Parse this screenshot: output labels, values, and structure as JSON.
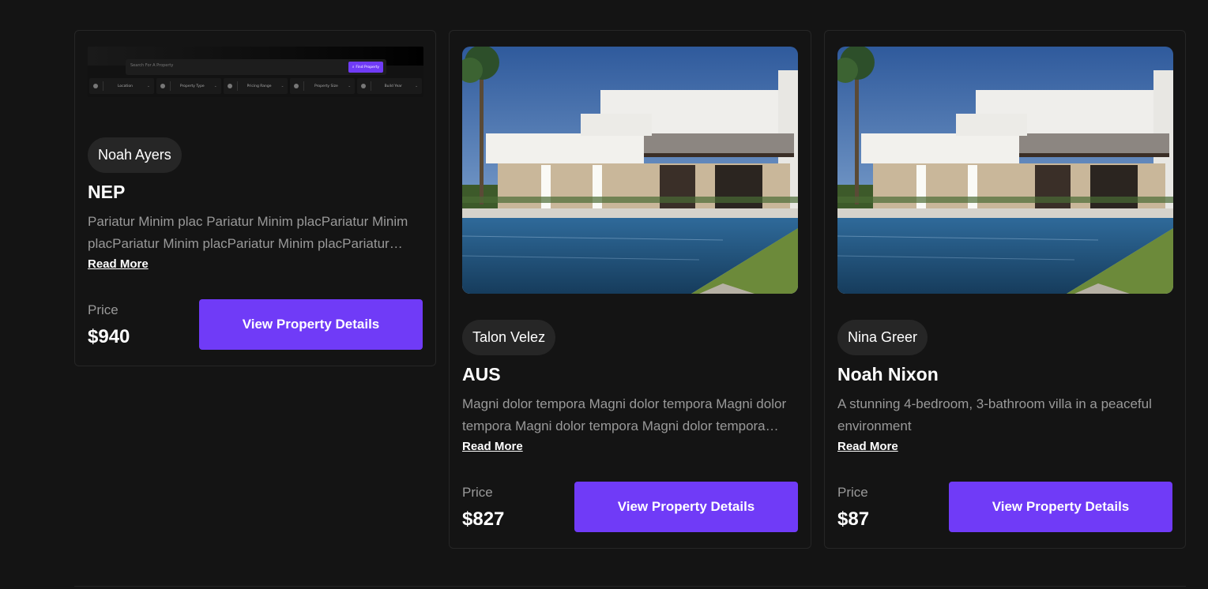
{
  "cards": [
    {
      "agent": "Noah Ayers",
      "title": "NEP",
      "description": "Pariatur Minim plac Pariatur Minim placPariatur Minim placPariatur Minim placPariatur Minim placPariatur Minim placPariatur Minim plac",
      "read_more": "Read More",
      "price_label": "Price",
      "price": "$940",
      "button": "View Property Details",
      "thumbnail": {
        "search_placeholder": "Search For A Property",
        "find_button": "Find Property",
        "filters": [
          "Location",
          "Property Type",
          "Pricing Range",
          "Property Size",
          "Build Year"
        ]
      }
    },
    {
      "agent": "Talon Velez",
      "title": "AUS",
      "description": "Magni dolor tempora Magni dolor tempora Magni dolor tempora Magni dolor tempora Magni dolor tempora Magni dolor tempora",
      "read_more": "Read More",
      "price_label": "Price",
      "price": "$827",
      "button": "View Property Details"
    },
    {
      "agent": "Nina Greer",
      "title": "Noah Nixon",
      "description": "A stunning 4-bedroom, 3-bathroom villa in a peaceful environment",
      "read_more": "Read More",
      "price_label": "Price",
      "price": "$87",
      "button": "View Property Details"
    }
  ],
  "colors": {
    "background": "#141414",
    "card_border": "#262626",
    "chip": "#262626",
    "accent": "#703bf7",
    "muted_text": "#999999"
  }
}
